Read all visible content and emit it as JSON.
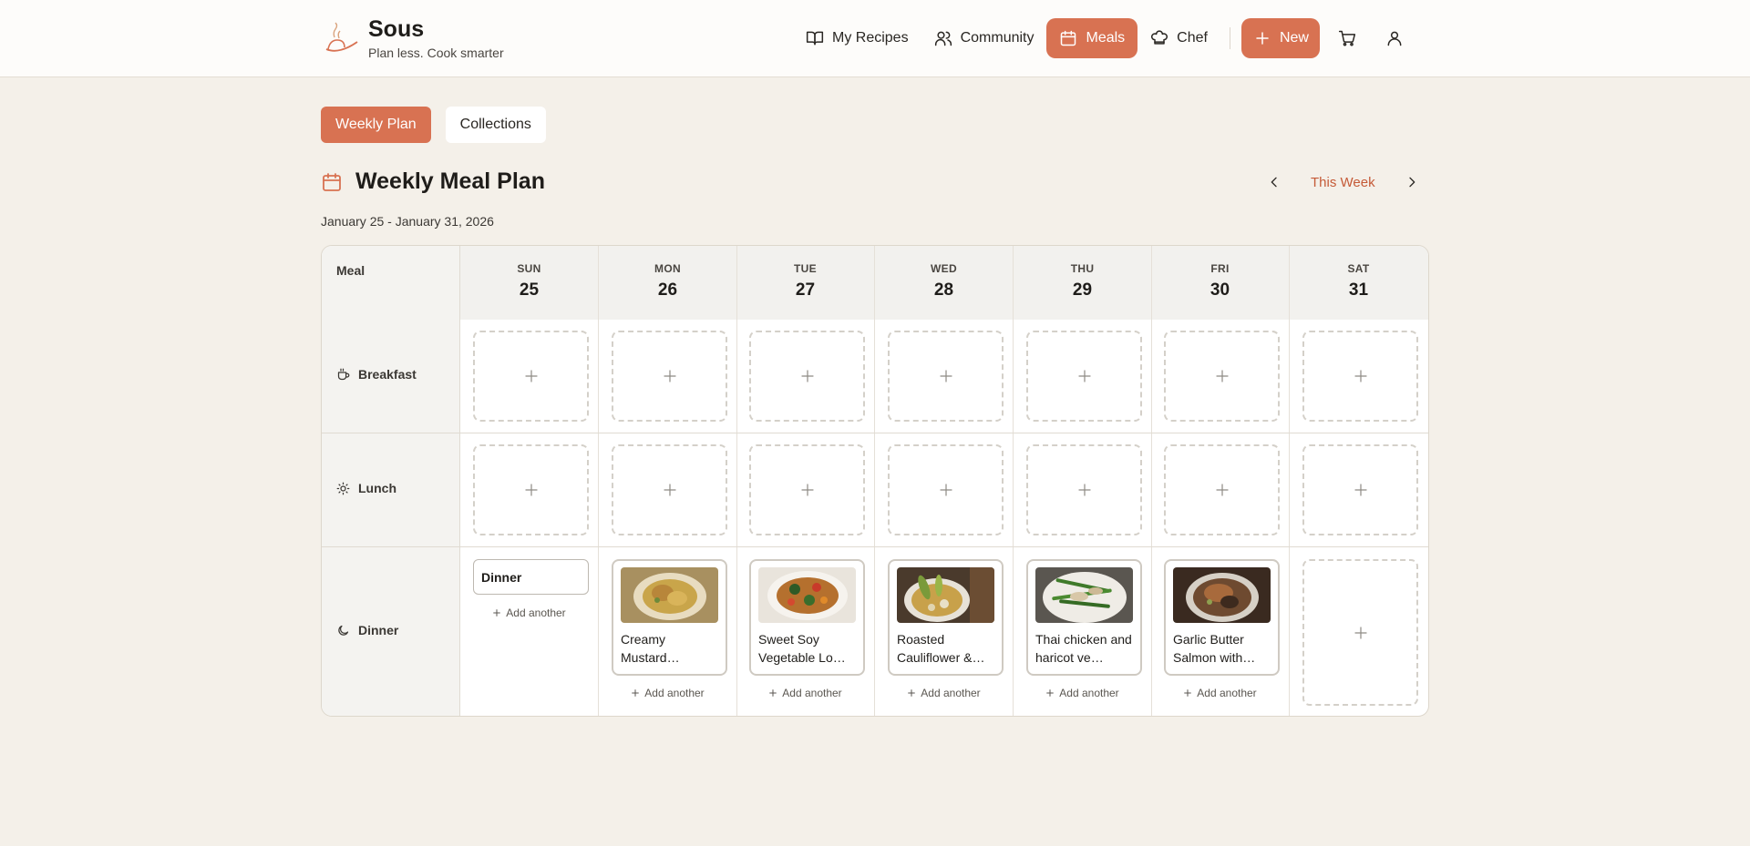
{
  "brand": {
    "name": "Sous",
    "tagline": "Plan less. Cook smarter"
  },
  "nav": {
    "my_recipes": "My Recipes",
    "community": "Community",
    "meals": "Meals",
    "chef": "Chef",
    "new": "New"
  },
  "tabs": {
    "weekly_plan": "Weekly Plan",
    "collections": "Collections"
  },
  "page": {
    "title": "Weekly Meal Plan",
    "this_week": "This Week",
    "date_range": "January 25 - January 31, 2026"
  },
  "grid": {
    "meal_header": "Meal",
    "days": [
      {
        "dow": "SUN",
        "num": "25"
      },
      {
        "dow": "MON",
        "num": "26"
      },
      {
        "dow": "TUE",
        "num": "27"
      },
      {
        "dow": "WED",
        "num": "28"
      },
      {
        "dow": "THU",
        "num": "29"
      },
      {
        "dow": "FRI",
        "num": "30"
      },
      {
        "dow": "SAT",
        "num": "31"
      }
    ],
    "meals": {
      "breakfast": "Breakfast",
      "lunch": "Lunch",
      "dinner": "Dinner"
    },
    "sunday_dinner_input": "Dinner",
    "add_another": "Add another",
    "dinners": [
      {
        "name": "Creamy Mustard…"
      },
      {
        "name": "Sweet Soy Vegetable Lo…"
      },
      {
        "name": "Roasted Cauliflower &…"
      },
      {
        "name": "Thai chicken and haricot ve…"
      },
      {
        "name": "Garlic Butter Salmon with…"
      }
    ]
  },
  "colors": {
    "accent": "#d87252",
    "background": "#f4f0e9",
    "accent_text": "#c55a37"
  }
}
